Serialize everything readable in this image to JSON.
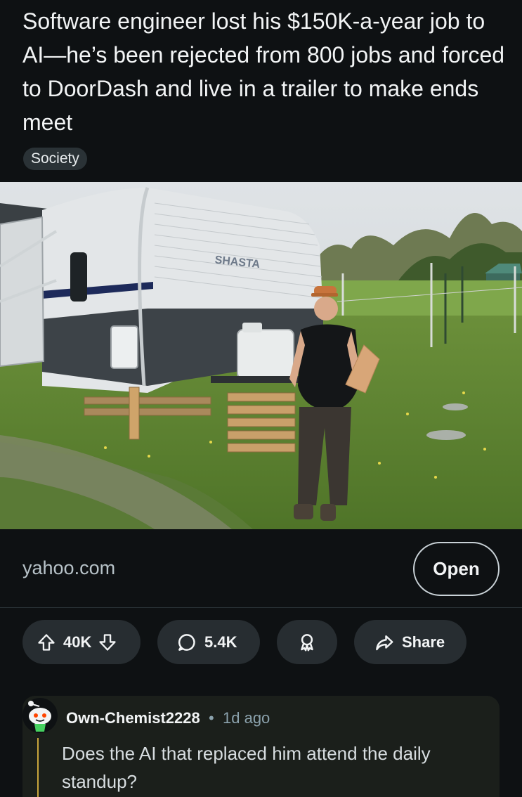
{
  "post": {
    "title": "Software engineer lost his $150K-a-year job to AI—he’s been rejected from 800 jobs and forced to DoorDash and live in a trailer to make ends meet",
    "flair": "Society"
  },
  "image": {
    "trailer_badge": "SHASTA"
  },
  "link": {
    "domain": "yahoo.com",
    "open_label": "Open"
  },
  "actions": {
    "upvotes": "40K",
    "comments": "5.4K",
    "share_label": "Share",
    "icons": [
      "upvote-icon",
      "downvote-icon",
      "comment-icon",
      "award-icon",
      "share-icon"
    ]
  },
  "comment": {
    "username": "Own-Chemist2228",
    "separator": "•",
    "time": "1d ago",
    "body": "Does the AI that replaced him attend the daily standup?",
    "thread_color": "#c8a53c"
  },
  "colors": {
    "background": "#0e1113",
    "pill": "#272d31",
    "flair_bg": "#2a3236",
    "muted_text": "#8ba2ad"
  }
}
